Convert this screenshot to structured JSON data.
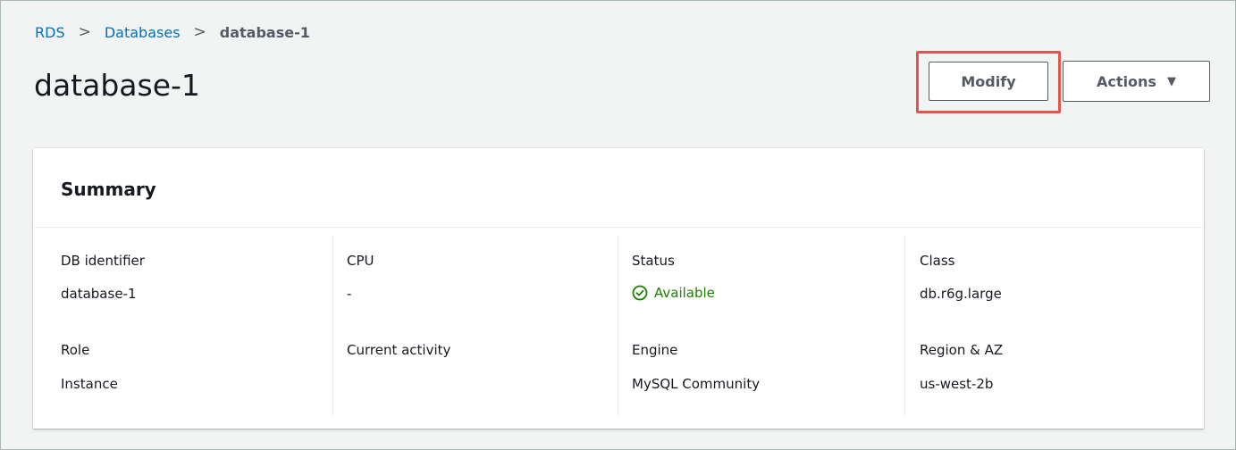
{
  "breadcrumb": {
    "items": [
      "RDS",
      "Databases",
      "database-1"
    ]
  },
  "page": {
    "title": "database-1"
  },
  "toolbar": {
    "modify_label": "Modify",
    "actions_label": "Actions",
    "actions_caret": "▼"
  },
  "summary": {
    "title": "Summary",
    "fields": {
      "db_identifier": {
        "label": "DB identifier",
        "value": "database-1"
      },
      "cpu": {
        "label": "CPU",
        "value": "-"
      },
      "status": {
        "label": "Status",
        "value": "Available",
        "icon": "check-circle-icon",
        "color": "#1d8102"
      },
      "class": {
        "label": "Class",
        "value": "db.r6g.large"
      },
      "role": {
        "label": "Role",
        "value": "Instance"
      },
      "current_activity": {
        "label": "Current activity",
        "value": ""
      },
      "engine": {
        "label": "Engine",
        "value": "MySQL Community"
      },
      "region_az": {
        "label": "Region & AZ",
        "value": "us-west-2b"
      }
    }
  },
  "colors": {
    "link": "#0073bb",
    "highlight": "#e2574c",
    "background": "#f2f3f3"
  }
}
